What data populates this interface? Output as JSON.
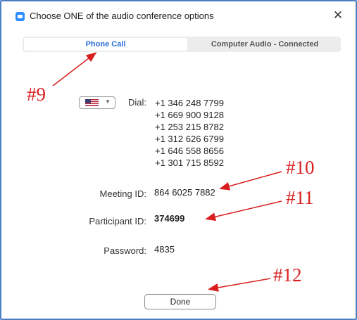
{
  "window": {
    "title": "Choose ONE of the audio conference options",
    "close_glyph": "✕"
  },
  "tabs": [
    {
      "label": "Phone Call",
      "selected": true
    },
    {
      "label": "Computer Audio - Connected",
      "selected": false
    }
  ],
  "dial": {
    "country": "US",
    "label": "Dial:",
    "numbers": [
      "+1 346 248 7799",
      "+1 669 900 9128",
      "+1 253 215 8782",
      "+1 312 626 6799",
      "+1 646 558 8656",
      "+1 301 715 8592"
    ]
  },
  "meeting_id": {
    "label": "Meeting ID:",
    "value": "864 6025 7882"
  },
  "participant_id": {
    "label": "Participant ID:",
    "value": "374699"
  },
  "password": {
    "label": "Password:",
    "value": "4835"
  },
  "done_label": "Done",
  "annotations": {
    "a9": "#9",
    "a10": "#10",
    "a11": "#11",
    "a12": "#12",
    "color": "#d81e1e"
  },
  "colors": {
    "accent": "#2d6fd6",
    "frame": "#4a7fc1",
    "annotation": "#d81e1e"
  }
}
